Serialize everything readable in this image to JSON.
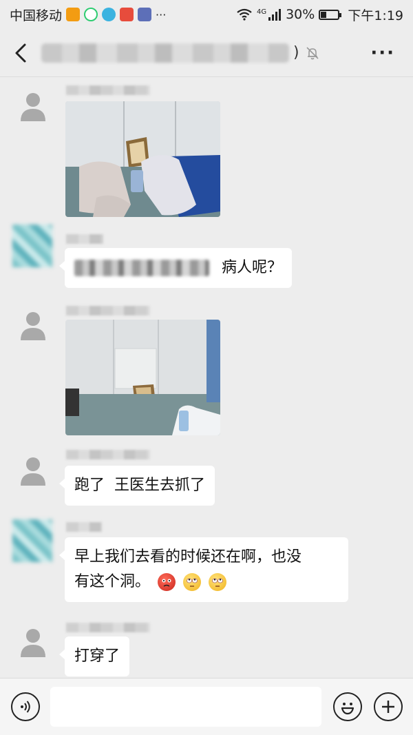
{
  "status_bar": {
    "carrier": "中国移动",
    "network": "4G",
    "battery": "30%",
    "battery_level": 0.3,
    "time": "下午1:19"
  },
  "header": {
    "back_icon": "chevron-left-icon",
    "title_paren": ")",
    "mute_icon": "bell-off-icon",
    "more_label": "···"
  },
  "messages": [
    {
      "type": "image",
      "sender_avatar": "default-user-icon",
      "scene": "hospital room with hole in wall and scattered sheets"
    },
    {
      "type": "text",
      "sender_avatar": "blurred-avatar",
      "text": "病人呢？"
    },
    {
      "type": "image",
      "sender_avatar": "default-user-icon",
      "scene": "empty room, hole at base of wall"
    },
    {
      "type": "text",
      "sender_avatar": "default-user-icon",
      "text": "跑了  王医生去抓了"
    },
    {
      "type": "text",
      "sender_avatar": "blurred-avatar",
      "line1": "早上我们去看的时候还在啊，也没",
      "line2": "有这个洞。"
    },
    {
      "type": "text",
      "sender_avatar": "default-user-icon",
      "text": "打穿了"
    }
  ],
  "input_bar": {
    "voice_icon": "voice-icon",
    "emoji_icon": "smiley-icon",
    "add_icon": "plus-icon",
    "placeholder": ""
  },
  "colors": {
    "background": "#ededed",
    "bubble": "#ffffff"
  }
}
